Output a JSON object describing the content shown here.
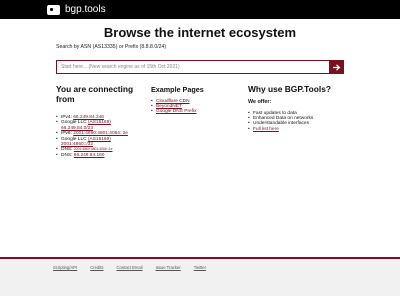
{
  "header": {
    "brand": "bgp.tools"
  },
  "hero": {
    "title": "Browse the internet ecosystem",
    "search_hint": "Search by ASN (AS13335) or Prefix (8.8.8.0/24)",
    "search_placeholder": "Start here... (New search engine as of 15th Oct 2021)"
  },
  "connecting": {
    "title": "You are connecting from",
    "items": [
      {
        "label": "IPv4: ",
        "link": "66.249.84.246"
      },
      {
        "label": "Google LLC ",
        "link": "(AS15169)"
      },
      {
        "label": "",
        "link": "66.249.84.0/23"
      },
      {
        "label": "IPv6: ",
        "link": "2001:4860:4801:4064::2e"
      },
      {
        "label": "Google LLC ",
        "link": "(AS15169)"
      },
      {
        "label": "",
        "link": "2001:4860::/32"
      },
      {
        "label": "DNS: ",
        "link": "2001:4860:4801:4066::1e"
      },
      {
        "label": "DNS: ",
        "link": "66.249.84.160"
      }
    ]
  },
  "example_pages": {
    "title": "Example Pages",
    "links": [
      "Cloudflare CDN",
      "BeyondNET",
      "Google DNS Prefix"
    ]
  },
  "why": {
    "title": "Why use BGP.Tools?",
    "offer_title": "We offer:",
    "items": [
      "Fast updates to data",
      "Enhanced Data on networks",
      "Understandable interfaces"
    ],
    "more_link": "Full list here"
  },
  "footer": {
    "links": [
      "Scripting/API",
      "Credits",
      "Contact Email",
      "Issue Tracker",
      "Twitter"
    ]
  },
  "colors": {
    "accent": "#7a1020",
    "topbar": "#000000",
    "footer_bg": "#f1f1f1"
  }
}
